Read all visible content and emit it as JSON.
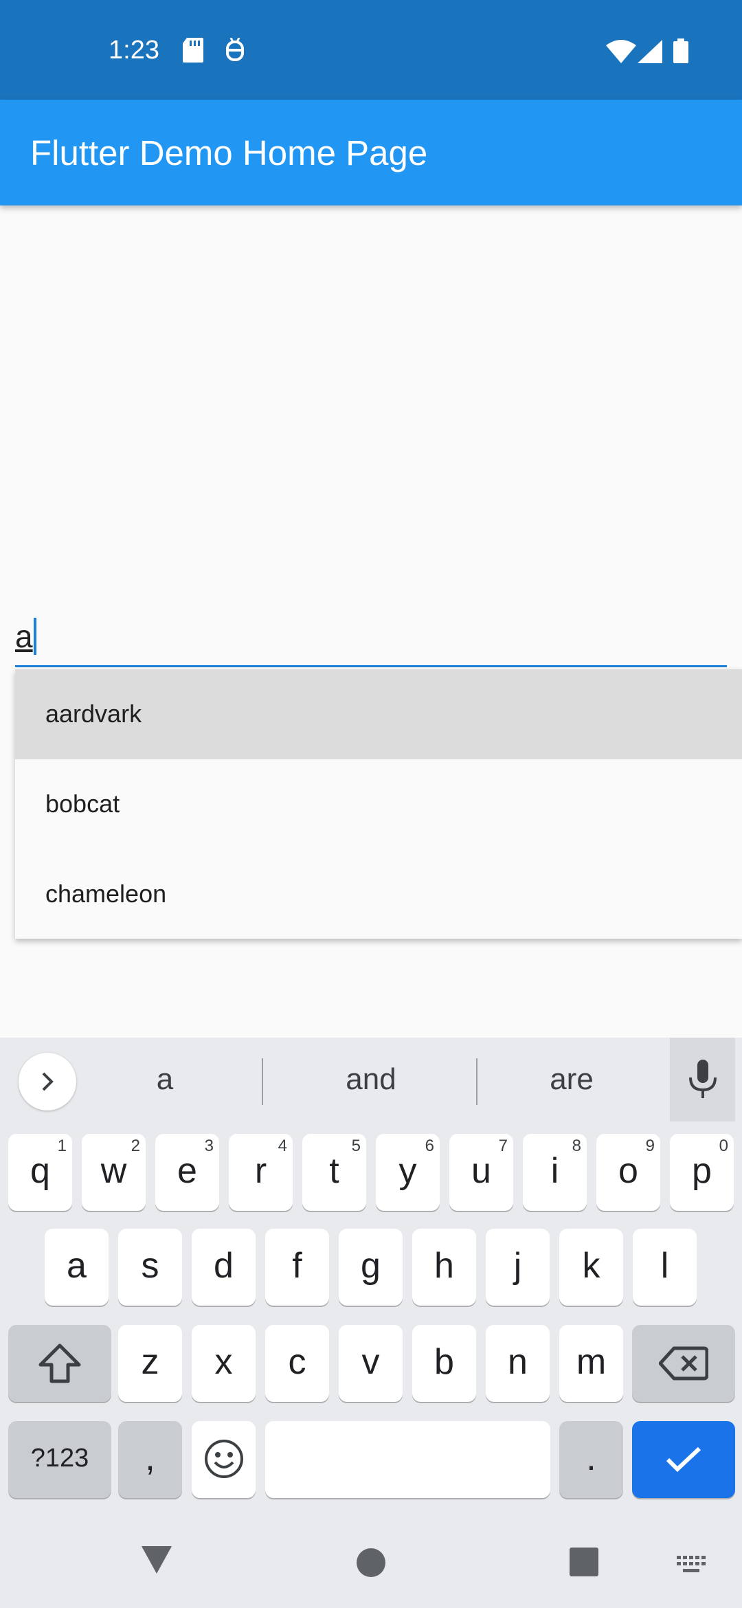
{
  "status_bar": {
    "time": "1:23",
    "icons": [
      "sd-card-icon",
      "bug-icon",
      "wifi-icon",
      "signal-icon",
      "battery-icon"
    ]
  },
  "app_bar": {
    "title": "Flutter Demo Home Page",
    "color": "#2196f3"
  },
  "text_field": {
    "value": "a"
  },
  "autocomplete": {
    "options": [
      {
        "label": "aardvark",
        "highlighted": true
      },
      {
        "label": "bobcat",
        "highlighted": false
      },
      {
        "label": "chameleon",
        "highlighted": false
      }
    ]
  },
  "keyboard": {
    "suggestions": [
      "a",
      "and",
      "are"
    ],
    "row1": [
      {
        "key": "q",
        "hint": "1"
      },
      {
        "key": "w",
        "hint": "2"
      },
      {
        "key": "e",
        "hint": "3"
      },
      {
        "key": "r",
        "hint": "4"
      },
      {
        "key": "t",
        "hint": "5"
      },
      {
        "key": "y",
        "hint": "6"
      },
      {
        "key": "u",
        "hint": "7"
      },
      {
        "key": "i",
        "hint": "8"
      },
      {
        "key": "o",
        "hint": "9"
      },
      {
        "key": "p",
        "hint": "0"
      }
    ],
    "row2": [
      "a",
      "s",
      "d",
      "f",
      "g",
      "h",
      "j",
      "k",
      "l"
    ],
    "row3": [
      "z",
      "x",
      "c",
      "v",
      "b",
      "n",
      "m"
    ],
    "symbols_label": "?123",
    "comma_label": ",",
    "period_label": ".",
    "enter_color": "#1a73e8"
  },
  "nav_bar": {
    "icons": [
      "back-icon",
      "home-icon",
      "recents-icon",
      "keyboard-switch-icon"
    ]
  }
}
